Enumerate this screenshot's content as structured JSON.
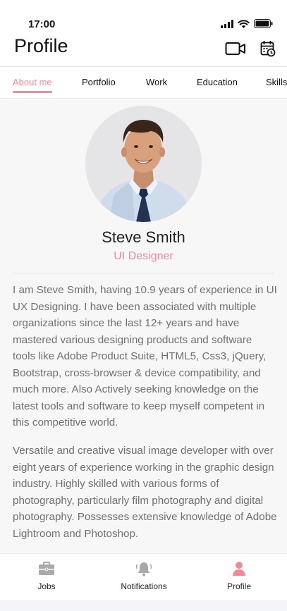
{
  "status_bar": {
    "time": "17:00"
  },
  "header": {
    "title": "Profile",
    "video_icon": "video-camera-icon",
    "calendar_icon": "calendar-clock-icon"
  },
  "tabs": [
    {
      "label": "About me",
      "active": true
    },
    {
      "label": "Portfolio",
      "active": false
    },
    {
      "label": "Work",
      "active": false
    },
    {
      "label": "Education",
      "active": false
    },
    {
      "label": "Skills",
      "active": false
    }
  ],
  "profile": {
    "name": "Steve Smith",
    "role": "UI Designer",
    "bio": [
      "I am Steve Smith, having 10.9 years of experience in UI UX Designing. I have been associated with multiple organizations since the last 12+ years and have mastered various designing products and software tools like Adobe Product Suite, HTML5, Css3, jQuery, Bootstrap, cross-browser & device compatibility, and much more. Also Actively seeking knowledge on the latest tools and software to keep myself competent in this competitive world.",
      "Versatile and creative visual image developer with over eight years of experience working in the graphic design industry. Highly skilled with various forms of photography, particularly film photography and digital photography. Possesses extensive knowledge of Adobe Lightroom and Photoshop."
    ]
  },
  "bottom_nav": [
    {
      "label": "Jobs",
      "icon": "briefcase-icon",
      "active": false
    },
    {
      "label": "Notifications",
      "icon": "bell-icon",
      "active": false
    },
    {
      "label": "Profile",
      "icon": "user-icon",
      "active": true
    }
  ],
  "colors": {
    "accent": "#f08a98",
    "text": "#222222",
    "muted_text": "#707070",
    "inactive_icon": "#a9a9a9"
  }
}
